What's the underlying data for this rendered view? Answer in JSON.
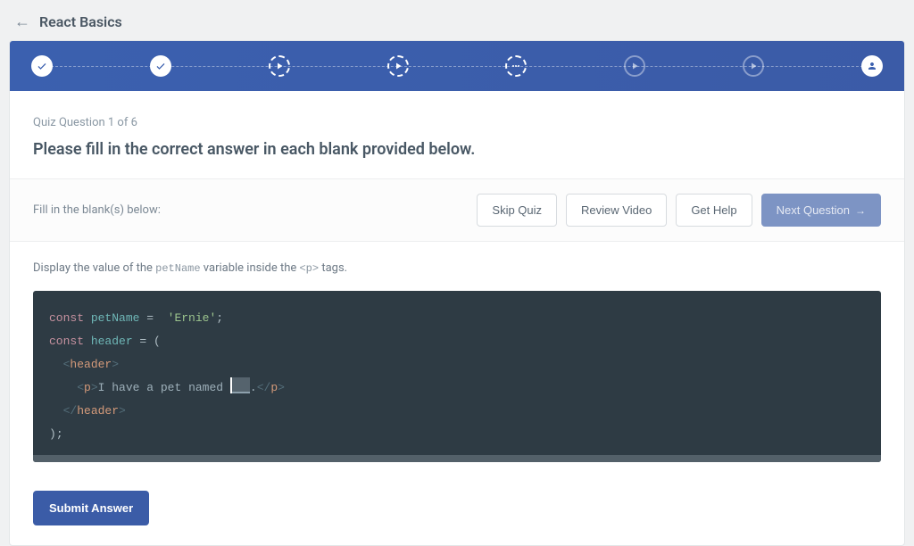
{
  "header": {
    "title": "React Basics"
  },
  "progress": {
    "steps": [
      {
        "type": "filled",
        "icon": "check"
      },
      {
        "type": "filled",
        "icon": "check"
      },
      {
        "type": "dashed",
        "icon": "play"
      },
      {
        "type": "dashed",
        "icon": "play"
      },
      {
        "type": "dashed",
        "icon": "dots"
      },
      {
        "type": "outline",
        "icon": "play"
      },
      {
        "type": "outline",
        "icon": "play"
      },
      {
        "type": "filled",
        "icon": "user"
      }
    ]
  },
  "quiz": {
    "counter": "Quiz Question 1 of 6",
    "instruction": "Please fill in the correct answer in each blank provided below.",
    "fill_label": "Fill in the blank(s) below:",
    "question_prefix": "Display the value of the ",
    "question_var": "petName",
    "question_mid": " variable inside the ",
    "question_tag": "<p>",
    "question_suffix": " tags."
  },
  "buttons": {
    "skip": "Skip Quiz",
    "review": "Review Video",
    "help": "Get Help",
    "next": "Next Question",
    "submit": "Submit Answer"
  },
  "code": {
    "line1_kw": "const",
    "line1_var": " petName",
    "line1_op": " = ",
    "line1_str": " 'Ernie'",
    "line1_end": ";",
    "line2_kw": "const",
    "line2_var": " header",
    "line2_op": " = ",
    "line2_paren": "(",
    "line3_indent": "  ",
    "line3_open": "<",
    "line3_tag": "header",
    "line3_close": ">",
    "line4_indent": "    ",
    "line4_open": "<",
    "line4_tag": "p",
    "line4_close": ">",
    "line4_text": "I have a pet named ",
    "line4_dot": ".",
    "line4_copen": "</",
    "line4_ctag": "p",
    "line4_cclose": ">",
    "line5_indent": "  ",
    "line5_open": "</",
    "line5_tag": "header",
    "line5_close": ">",
    "line6_paren": ")",
    "line6_end": ";"
  }
}
